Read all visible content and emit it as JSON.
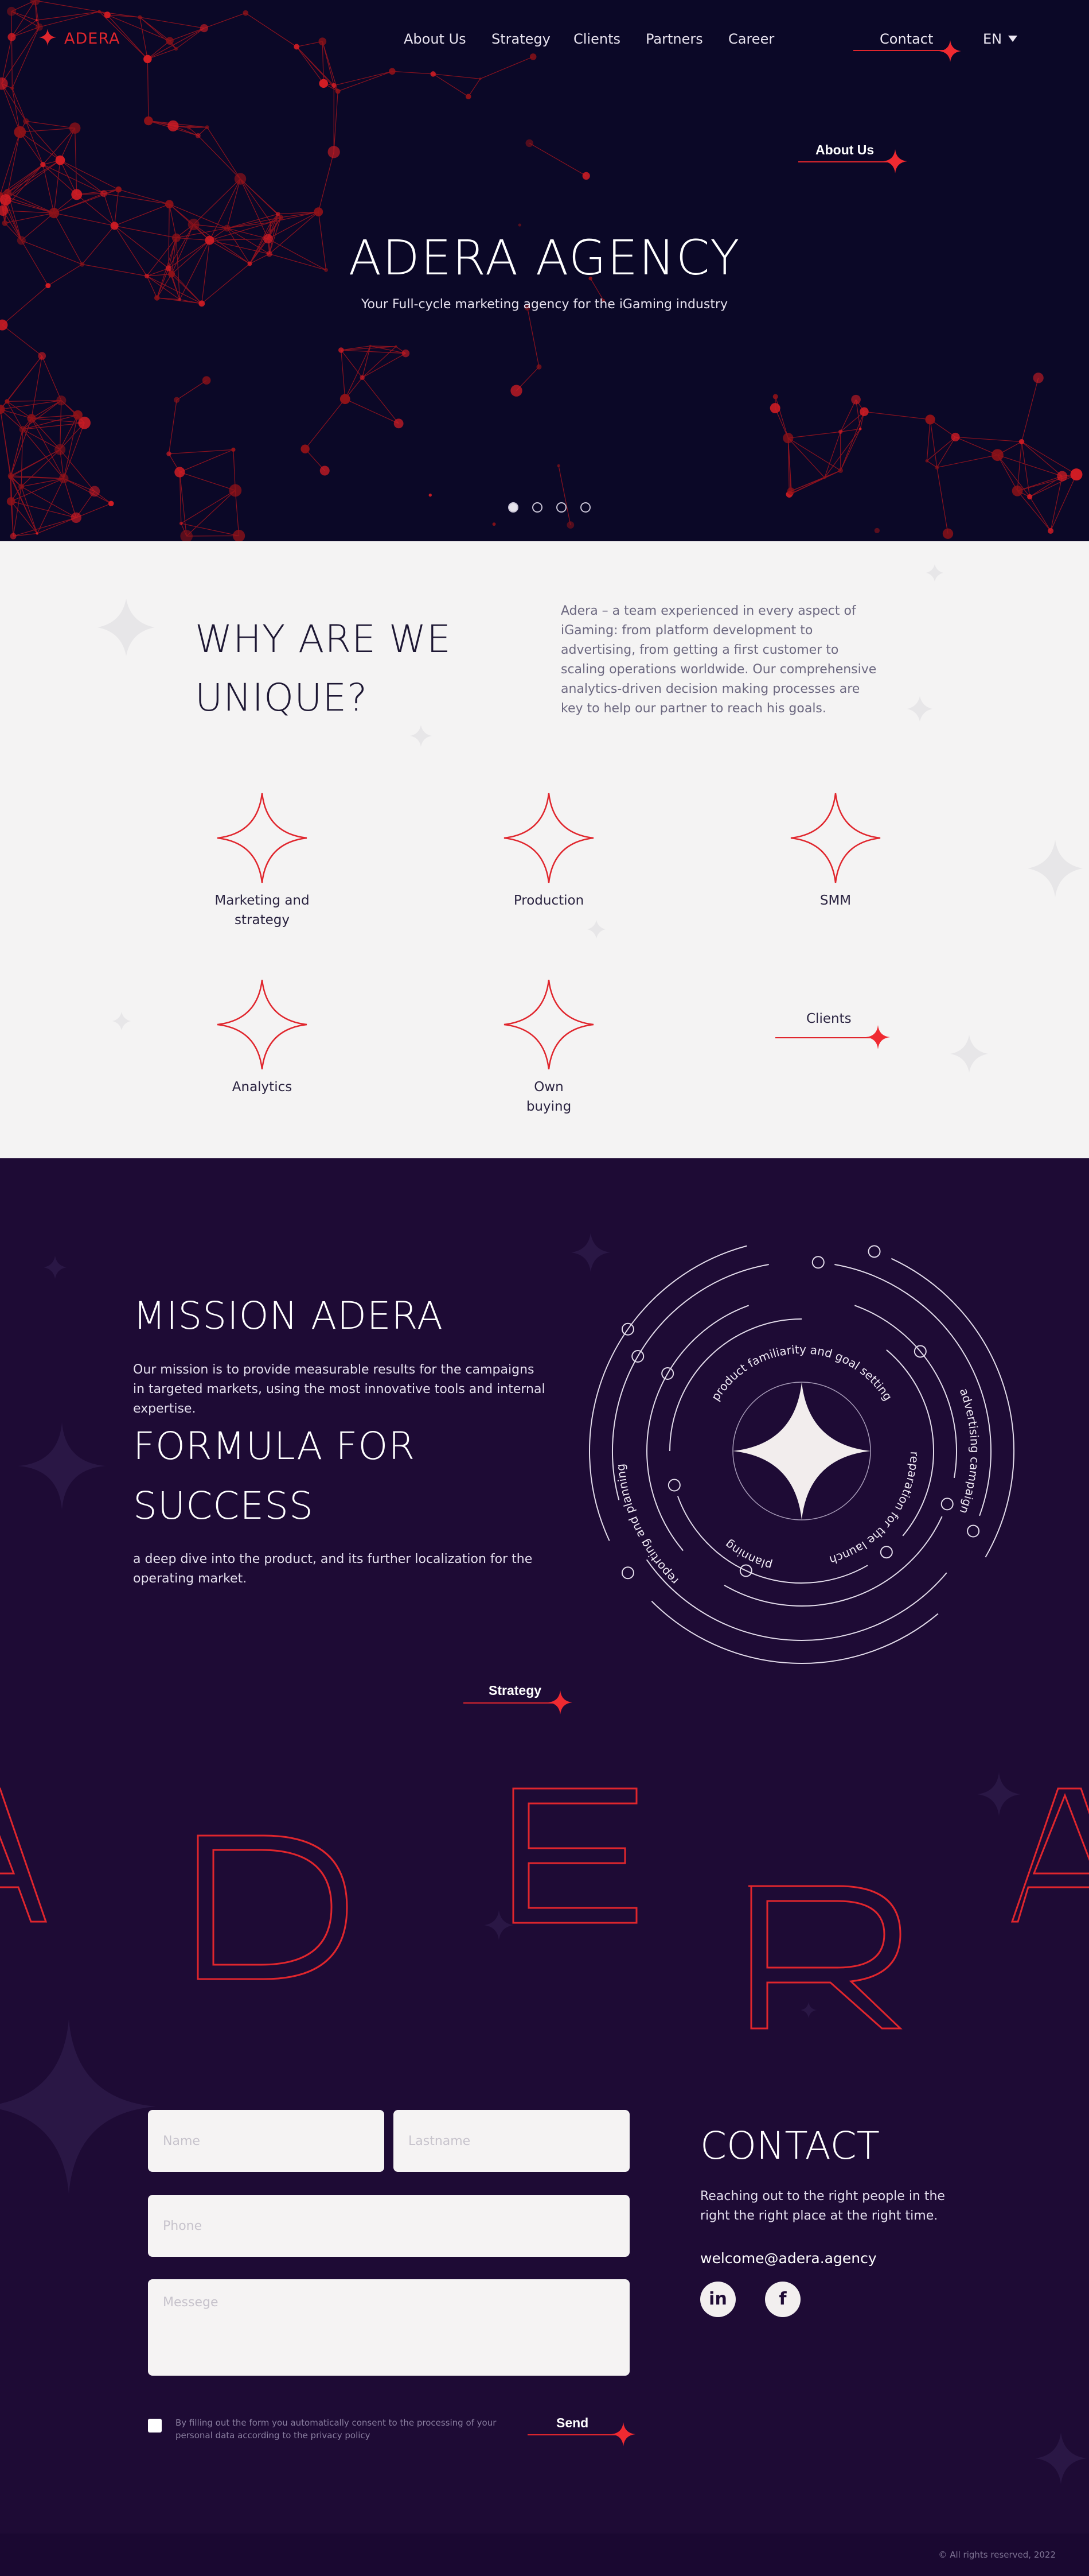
{
  "brand": {
    "logo_text": "ADERA",
    "accent_color": "#e0262d",
    "dark_bg": "#0b0827",
    "section_bg": "#1e0b35"
  },
  "nav": {
    "links": [
      "About Us",
      "Strategy",
      "Clients",
      "Partners",
      "Career"
    ],
    "contact_label": "Contact",
    "language": "EN",
    "language_icon": "caret-down-icon"
  },
  "hero": {
    "section_label": "About Us",
    "title": "ADERA AGENCY",
    "subtitle": "Your Full-cycle marketing agency for the iGaming industry",
    "slides_count": 4,
    "active_slide": 1
  },
  "why": {
    "title_line1": "WHY ARE WE",
    "title_line2": "UNIQUE?",
    "description": "Adera – a team experienced in every aspect of iGaming: from platform development to advertising, from getting a first customer to scaling operations worldwide. Our comprehensive analytics-driven decision making processes are key to help our partner to reach his goals.",
    "services": [
      "Marketing and strategy",
      "Production",
      "SMM",
      "Analytics",
      "Own buying"
    ],
    "next_label": "Clients"
  },
  "mission": {
    "title": "MISSION ADERA",
    "text": "Our mission is to provide measurable results for the campaigns in targeted markets, using the most innovative tools and internal expertise.",
    "formula_line1": "FORMULA FOR",
    "formula_line2": "SUCCESS",
    "formula_text": "a deep dive into the product, and its further localization for the operating market.",
    "cycle": [
      "product familiarity and goal setting",
      "advertising campaign",
      "preparation for the launch",
      "planning",
      "reporting and planning"
    ],
    "strategy_label": "Strategy",
    "letters": [
      "A",
      "D",
      "E",
      "R",
      "A"
    ]
  },
  "form": {
    "name_placeholder": "Name",
    "lastname_placeholder": "Lastname",
    "phone_placeholder": "Phone",
    "message_placeholder": "Messege",
    "consent": "By filling out the form you automatically consent to the processing of your personal data according to the privacy policy",
    "send_label": "Send"
  },
  "contact": {
    "title": "CONTACT",
    "text": "Reaching out to the right people in the right the right place at the right time.",
    "email": "welcome@adera.agency",
    "social": [
      {
        "label": "in",
        "icon": "linkedin-icon"
      },
      {
        "label": "f",
        "icon": "facebook-icon"
      }
    ]
  },
  "footer": {
    "copyright": "© All rights reserved, 2022"
  }
}
